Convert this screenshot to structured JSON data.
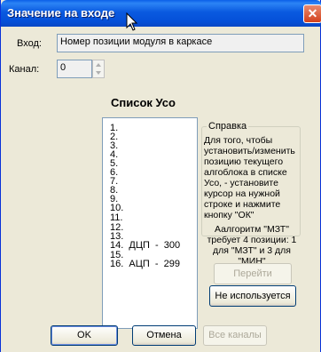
{
  "window": {
    "title": "Значение на входе",
    "close_icon": "close-icon",
    "accent": "#0a5ae0"
  },
  "input": {
    "label": "Вход:",
    "value": "Номер позиции модуля в каркасе"
  },
  "channel": {
    "label": "Канал:",
    "value": "0"
  },
  "uso_list": {
    "title": "Список Усо",
    "items": [
      "1.",
      "2.",
      "3.",
      "4.",
      "5.",
      "6.",
      "7.",
      "8.",
      "9.",
      "10.",
      "11.",
      "12.",
      "13.",
      "14.  ДЦП  -  300",
      "15.",
      "16.  АЦП  -  299"
    ]
  },
  "help": {
    "title": "Справка",
    "text1": "Для того, чтобы установить/изменить позицию текущего алгоблока в списке Усо, - установите курсор на нужной строке и нажмите кнопку \"ОК\"",
    "text2": "Аалгоритм  \"МЗТ\" требует 4 позиции: 1 для \"МЗТ\" и 3 для \"МИН\""
  },
  "buttons": {
    "goto": "Перейти",
    "not_used": "Не используется",
    "ok": "OK",
    "cancel": "Отмена",
    "all_channels": "Все каналы"
  }
}
